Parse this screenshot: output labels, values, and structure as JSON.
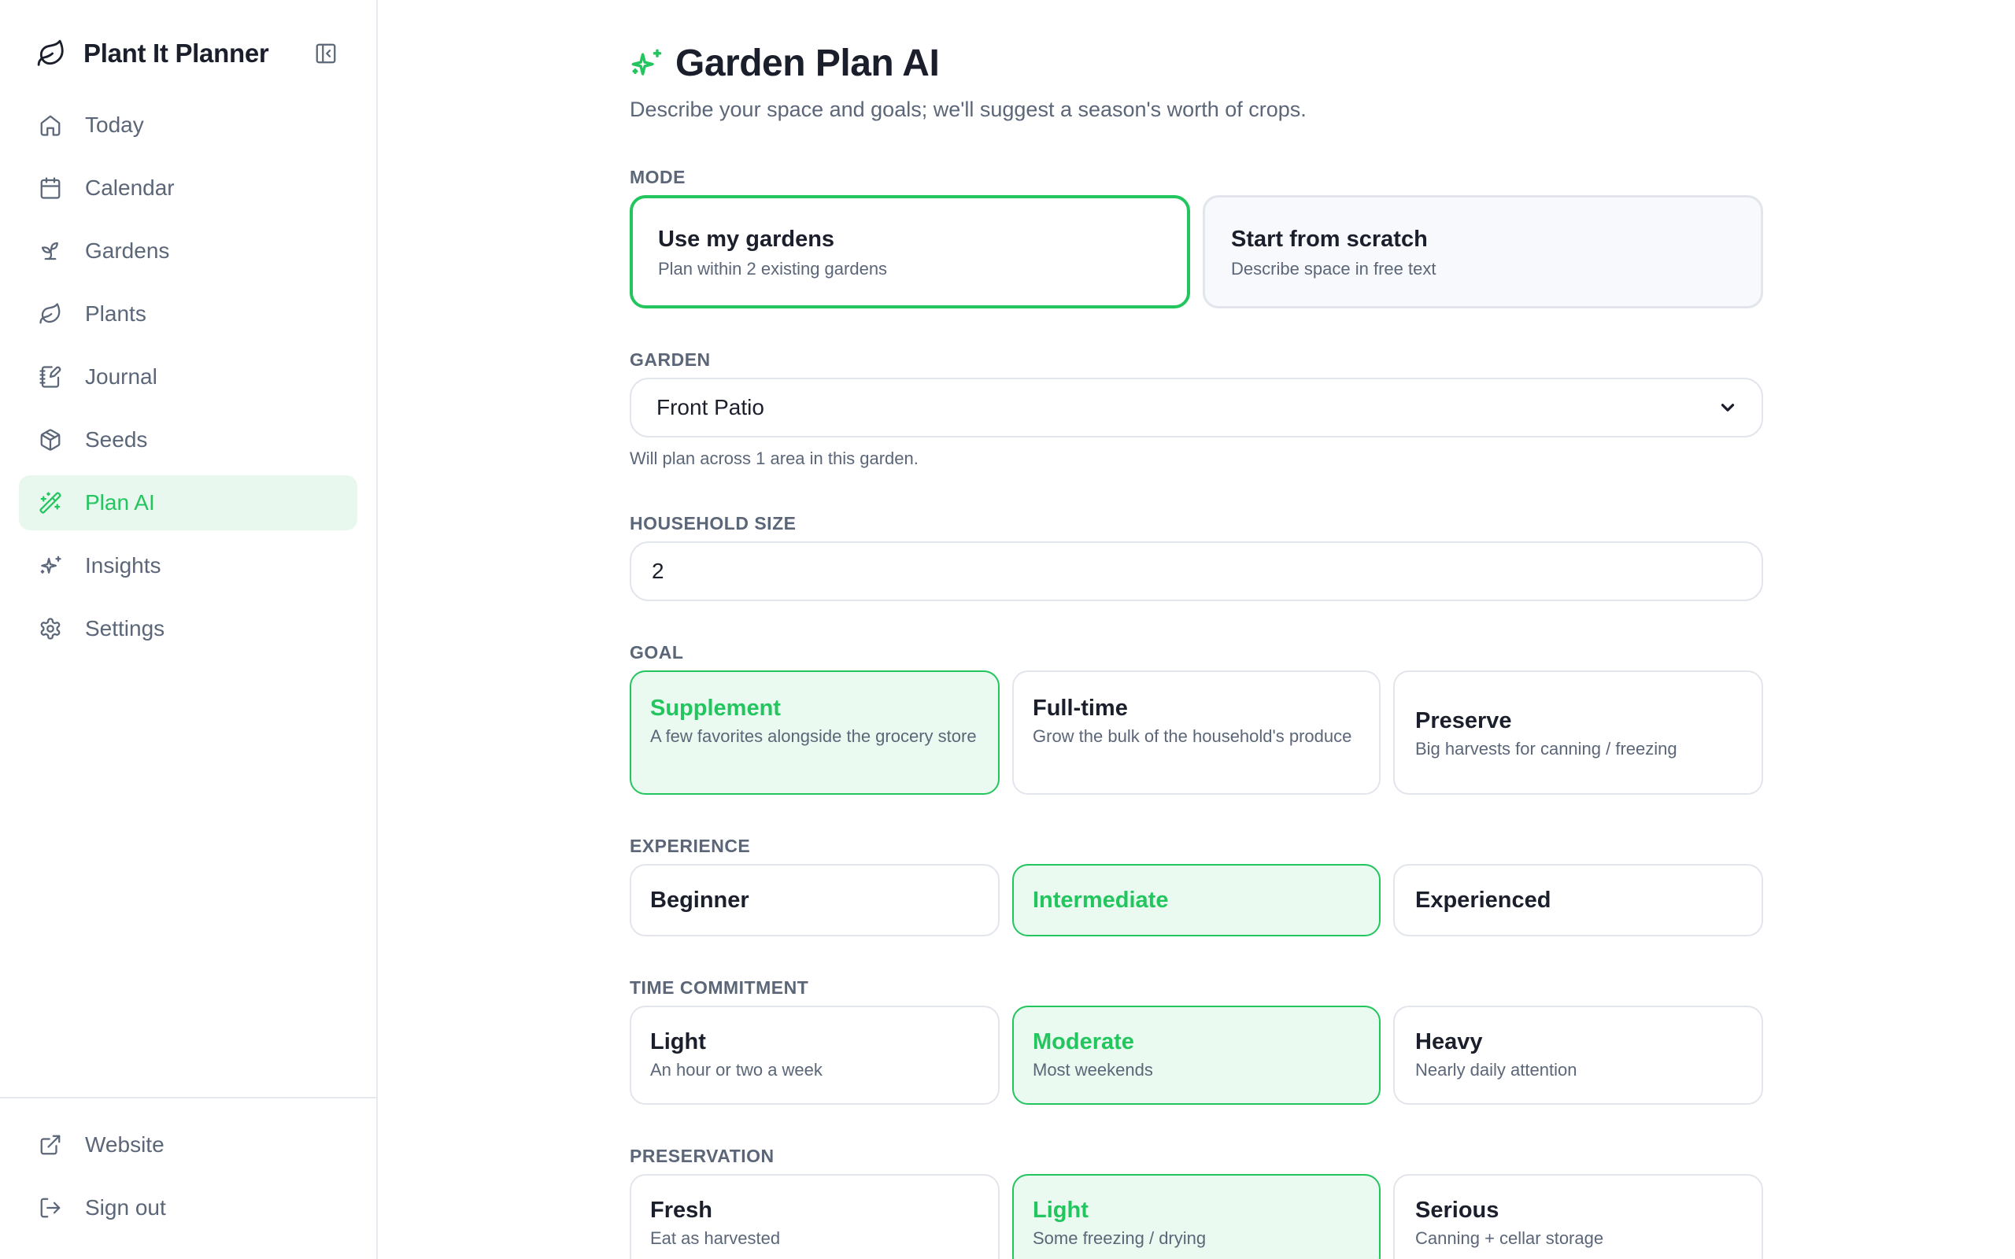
{
  "sidebar": {
    "brand": "Plant It Planner",
    "items": [
      {
        "label": "Today",
        "icon": "home-icon"
      },
      {
        "label": "Calendar",
        "icon": "calendar-icon"
      },
      {
        "label": "Gardens",
        "icon": "sprout-icon"
      },
      {
        "label": "Plants",
        "icon": "leaf-icon"
      },
      {
        "label": "Journal",
        "icon": "notebook-pen-icon"
      },
      {
        "label": "Seeds",
        "icon": "package-icon"
      },
      {
        "label": "Plan AI",
        "icon": "wand-sparkles-icon",
        "active": true
      },
      {
        "label": "Insights",
        "icon": "sparkles-icon"
      },
      {
        "label": "Settings",
        "icon": "gear-icon"
      }
    ],
    "footer": [
      {
        "label": "Website",
        "icon": "external-link-icon"
      },
      {
        "label": "Sign out",
        "icon": "log-out-icon"
      }
    ]
  },
  "header": {
    "title": "Garden Plan AI",
    "subtitle": "Describe your space and goals; we'll suggest a season's worth of crops."
  },
  "mode": {
    "label": "MODE",
    "options": [
      {
        "title": "Use my gardens",
        "desc": "Plan within 2 existing gardens",
        "selected": true
      },
      {
        "title": "Start from scratch",
        "desc": "Describe space in free text",
        "selected": false
      }
    ]
  },
  "garden": {
    "label": "GARDEN",
    "value": "Front Patio",
    "hint": "Will plan across 1 area in this garden."
  },
  "household": {
    "label": "HOUSEHOLD SIZE",
    "value": "2"
  },
  "goal": {
    "label": "GOAL",
    "options": [
      {
        "title": "Supplement",
        "desc": "A few favorites alongside the grocery store",
        "selected": true
      },
      {
        "title": "Full-time",
        "desc": "Grow the bulk of the household's produce",
        "selected": false
      },
      {
        "title": "Preserve",
        "desc": "Big harvests for canning / freezing",
        "selected": false
      }
    ]
  },
  "experience": {
    "label": "EXPERIENCE",
    "options": [
      {
        "title": "Beginner",
        "selected": false
      },
      {
        "title": "Intermediate",
        "selected": true
      },
      {
        "title": "Experienced",
        "selected": false
      }
    ]
  },
  "time": {
    "label": "TIME COMMITMENT",
    "options": [
      {
        "title": "Light",
        "desc": "An hour or two a week",
        "selected": false
      },
      {
        "title": "Moderate",
        "desc": "Most weekends",
        "selected": true
      },
      {
        "title": "Heavy",
        "desc": "Nearly daily attention",
        "selected": false
      }
    ]
  },
  "preservation": {
    "label": "PRESERVATION",
    "options": [
      {
        "title": "Fresh",
        "desc": "Eat as harvested",
        "selected": false
      },
      {
        "title": "Light",
        "desc": "Some freezing / drying",
        "selected": true
      },
      {
        "title": "Serious",
        "desc": "Canning + cellar storage",
        "selected": false
      }
    ]
  },
  "colors": {
    "accent": "#22c55e",
    "accent_bg": "#eafaf0",
    "muted_text": "#5b6678",
    "border": "#e2e6ec"
  }
}
